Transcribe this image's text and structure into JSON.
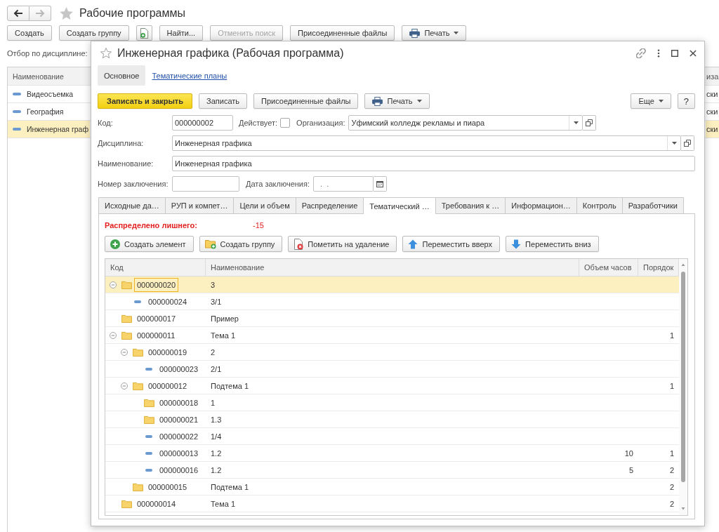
{
  "main_window": {
    "nav": [
      {
        "kind": "back",
        "disabled": false
      },
      {
        "kind": "forward",
        "disabled": true
      }
    ],
    "title": "Рабочие программы",
    "toolbar": [
      {
        "kind": "text",
        "label": "Создать",
        "disabled": false
      },
      {
        "kind": "text",
        "label": "Создать группу",
        "disabled": false
      },
      {
        "kind": "icon",
        "disabled": false
      },
      {
        "kind": "text",
        "label": "Найти...",
        "disabled": false
      },
      {
        "kind": "text",
        "label": "Отменить поиск",
        "disabled": true
      },
      {
        "kind": "text",
        "label": "Присоединенные файлы",
        "disabled": false
      },
      {
        "kind": "print",
        "label": "Печать",
        "disabled": false
      }
    ],
    "filter_label": "Отбор по дисциплине:",
    "list": {
      "columns": [
        "Наименование",
        "иза"
      ],
      "rows": [
        {
          "cells": [
            "Видеосъемка",
            "ски"
          ],
          "selected": false
        },
        {
          "cells": [
            "География",
            "ски"
          ],
          "selected": false
        },
        {
          "cells": [
            "Инженерная граф",
            "ски"
          ],
          "selected": true
        }
      ]
    }
  },
  "dialog": {
    "title": "Инженерная графика (Рабочая программа)",
    "sections": [
      {
        "label": "Основное",
        "selected": true
      },
      {
        "label": "Тематические планы",
        "selected": false
      }
    ],
    "commands": [
      {
        "kind": "primary",
        "label": "Записать и закрыть"
      },
      {
        "kind": "plain",
        "label": "Записать"
      },
      {
        "kind": "plain",
        "label": "Присоединенные файлы"
      },
      {
        "kind": "print",
        "label": "Печать"
      }
    ],
    "commands_right": [
      {
        "kind": "menu",
        "label": "Еще"
      },
      {
        "kind": "plain",
        "label": "?"
      }
    ],
    "code": {
      "label": "Код:",
      "value": "000000002"
    },
    "active": {
      "label": "Действует:",
      "checked": false
    },
    "organization": {
      "label": "Организация:",
      "value": "Уфимский колледж рекламы и пиара"
    },
    "discipline": {
      "label": "Дисциплина:",
      "value": "Инженерная графика"
    },
    "name": {
      "label": "Наименование:",
      "value": "Инженерная графика"
    },
    "conclusion_number": {
      "label": "Номер заключения:"
    },
    "conclusion_date": {
      "label": "Дата заключения:",
      "placeholder": ".  ."
    },
    "tabs": [
      {
        "label": "Исходные да…",
        "selected": false
      },
      {
        "label": "РУП и компет…",
        "selected": false
      },
      {
        "label": "Цели и объем",
        "selected": false
      },
      {
        "label": "Распределение",
        "selected": false
      },
      {
        "label": "Тематический …",
        "selected": true
      },
      {
        "label": "Требования к …",
        "selected": false
      },
      {
        "label": "Информацион…",
        "selected": false
      },
      {
        "label": "Контроль",
        "selected": false
      },
      {
        "label": "Разработчики",
        "selected": false
      }
    ],
    "tab_panel": {
      "warning": {
        "label": "Распределено лишнего:",
        "value": "-15"
      },
      "toolbar": [
        {
          "kind": "create",
          "label": "Создать элемент"
        },
        {
          "kind": "group",
          "label": "Создать группу"
        },
        {
          "kind": "delete",
          "label": "Пометить на удаление"
        },
        {
          "kind": "up",
          "label": "Переместить вверх"
        },
        {
          "kind": "down",
          "label": "Переместить вниз"
        }
      ],
      "table": {
        "columns": [
          "Код",
          "Наименование",
          "Объем часов",
          "Порядок"
        ],
        "rows": [
          {
            "kind": "folder",
            "code": "000000020",
            "name": "3",
            "expanded": true,
            "selected": true,
            "children": [
              {
                "kind": "element",
                "code": "000000024",
                "name": "3/1",
                "expanded": false,
                "selected": false
              }
            ]
          },
          {
            "kind": "folder",
            "code": "000000017",
            "name": "Пример",
            "expanded": false,
            "selected": false
          },
          {
            "kind": "folder",
            "code": "000000011",
            "name": "Тема 1",
            "order": "1",
            "expanded": true,
            "selected": false,
            "children": [
              {
                "kind": "folder",
                "code": "000000019",
                "name": "2",
                "expanded": true,
                "selected": false,
                "children": [
                  {
                    "kind": "element",
                    "code": "000000023",
                    "name": "2/1",
                    "expanded": false,
                    "selected": false
                  }
                ]
              },
              {
                "kind": "folder",
                "code": "000000012",
                "name": "Подтема 1",
                "order": "1",
                "expanded": true,
                "selected": false,
                "children": [
                  {
                    "kind": "folder",
                    "code": "000000018",
                    "name": "1",
                    "expanded": false,
                    "selected": false
                  },
                  {
                    "kind": "folder",
                    "code": "000000021",
                    "name": "1.3",
                    "expanded": false,
                    "selected": false
                  },
                  {
                    "kind": "element",
                    "code": "000000022",
                    "name": "1/4",
                    "expanded": false,
                    "selected": false
                  },
                  {
                    "kind": "element",
                    "code": "000000013",
                    "name": "1.2",
                    "hours": "10",
                    "order": "1",
                    "expanded": false,
                    "selected": false
                  },
                  {
                    "kind": "element",
                    "code": "000000016",
                    "name": "1.2",
                    "hours": "5",
                    "order": "2",
                    "expanded": false,
                    "selected": false
                  }
                ]
              },
              {
                "kind": "folder",
                "code": "000000015",
                "name": "Подтема 1",
                "order": "2",
                "expanded": false,
                "selected": false
              }
            ]
          },
          {
            "kind": "folder",
            "code": "000000014",
            "name": "Тема 1",
            "order": "2",
            "expanded": false,
            "selected": false
          }
        ]
      }
    }
  }
}
